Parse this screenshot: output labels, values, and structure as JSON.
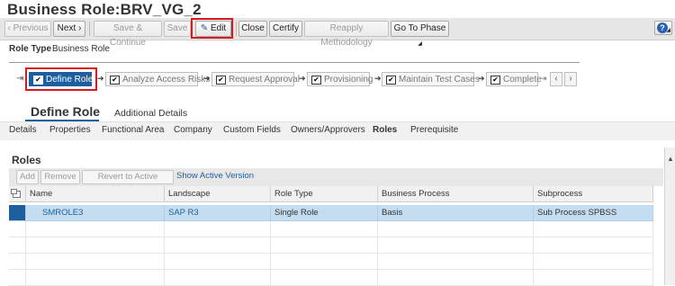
{
  "title": "Business Role:BRV_VG_2",
  "toolbar": {
    "previous": "Previous",
    "next": "Next",
    "save_continue": "Save & Continue",
    "save": "Save",
    "edit": "Edit",
    "close": "Close",
    "certify": "Certify",
    "reapply": "Reapply Methodology",
    "go_to_phase": "Go To Phase",
    "help_glyph": "?"
  },
  "role_type": {
    "label": "Role Type",
    "value": "Business Role"
  },
  "roadmap": {
    "phases": [
      {
        "label": "Define Role",
        "active": true
      },
      {
        "label": "Analyze Access Risks",
        "active": false
      },
      {
        "label": "Request Approval",
        "active": false
      },
      {
        "label": "Provisioning",
        "active": false
      },
      {
        "label": "Maintain Test Cases",
        "active": false
      },
      {
        "label": "Complete",
        "active": false
      }
    ],
    "checkmark": "✔",
    "arrow": "➔",
    "start_marker": "⇥",
    "nav_prev": "‹",
    "nav_next": "›"
  },
  "main_tabs": {
    "define_role": "Define Role",
    "additional_details": "Additional Details"
  },
  "subtabs": [
    "Details",
    "Properties",
    "Functional Area",
    "Company",
    "Custom Fields",
    "Owners/Approvers",
    "Roles",
    "Prerequisite"
  ],
  "active_subtab": "Roles",
  "roles": {
    "title": "Roles",
    "buttons": {
      "add": "Add",
      "remove": "Remove",
      "revert": "Revert to Active Version",
      "show_active": "Show Active Version"
    },
    "columns": [
      "Name",
      "Landscape",
      "Role Type",
      "Business Process",
      "Subprocess"
    ],
    "rows": [
      {
        "name": "SMROLE3",
        "landscape": "SAP R3",
        "role_type": "Single Role",
        "business_process": "Basis",
        "subprocess": "Sub Process SPBSS"
      }
    ]
  },
  "colors": {
    "accent": "#1d5f9e",
    "highlight": "#d71920",
    "selected_row": "#c4ddf0",
    "link": "#1f5e9c"
  }
}
